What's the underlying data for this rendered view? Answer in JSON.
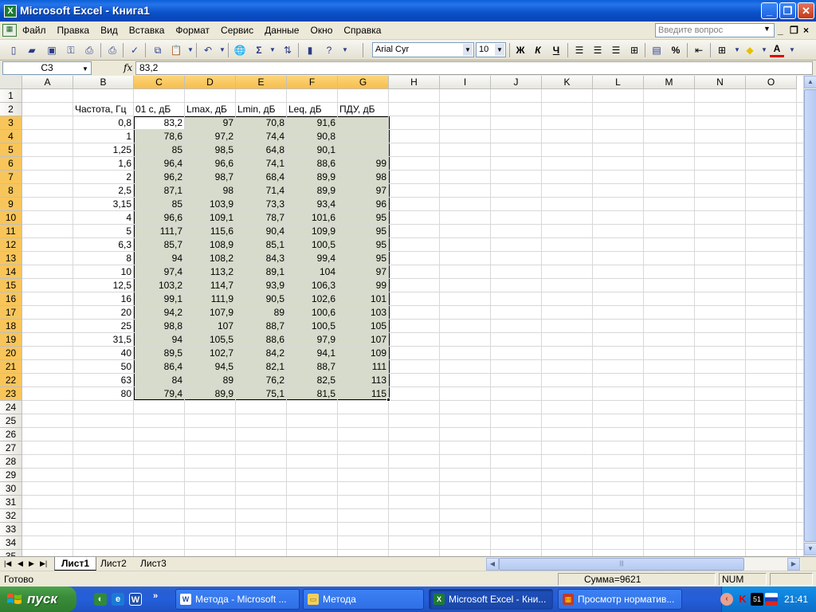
{
  "window": {
    "title": "Microsoft Excel - Книга1"
  },
  "menu": {
    "items": [
      "Файл",
      "Правка",
      "Вид",
      "Вставка",
      "Формат",
      "Сервис",
      "Данные",
      "Окно",
      "Справка"
    ],
    "help_placeholder": "Введите вопрос"
  },
  "toolbar": {
    "font": "Arial Cyr",
    "size": "10"
  },
  "formula_bar": {
    "name_box": "C3",
    "fx": "fx",
    "content": "83,2"
  },
  "grid": {
    "columns": [
      "A",
      "B",
      "C",
      "D",
      "E",
      "F",
      "G",
      "H",
      "I",
      "J",
      "K",
      "L",
      "M",
      "N",
      "O"
    ],
    "rows": [
      "1",
      "2",
      "3",
      "4",
      "5",
      "6",
      "7",
      "8",
      "9",
      "10",
      "11",
      "12",
      "13",
      "14",
      "15",
      "16",
      "17",
      "18",
      "19",
      "20",
      "21",
      "22",
      "23",
      "24",
      "25",
      "26",
      "27",
      "28",
      "29",
      "30",
      "31",
      "32",
      "33",
      "34",
      "35"
    ],
    "headers": [
      "Частота, Гц",
      "01 с, дБ",
      "Lmax, дБ",
      "Lmin, дБ",
      "Leq, дБ",
      "ПДУ, дБ"
    ],
    "data": [
      [
        "0,8",
        "83,2",
        "97",
        "70,8",
        "91,6",
        ""
      ],
      [
        "1",
        "78,6",
        "97,2",
        "74,4",
        "90,8",
        ""
      ],
      [
        "1,25",
        "85",
        "98,5",
        "64,8",
        "90,1",
        ""
      ],
      [
        "1,6",
        "96,4",
        "96,6",
        "74,1",
        "88,6",
        "99"
      ],
      [
        "2",
        "96,2",
        "98,7",
        "68,4",
        "89,9",
        "98"
      ],
      [
        "2,5",
        "87,1",
        "98",
        "71,4",
        "89,9",
        "97"
      ],
      [
        "3,15",
        "85",
        "103,9",
        "73,3",
        "93,4",
        "96"
      ],
      [
        "4",
        "96,6",
        "109,1",
        "78,7",
        "101,6",
        "95"
      ],
      [
        "5",
        "111,7",
        "115,6",
        "90,4",
        "109,9",
        "95"
      ],
      [
        "6,3",
        "85,7",
        "108,9",
        "85,1",
        "100,5",
        "95"
      ],
      [
        "8",
        "94",
        "108,2",
        "84,3",
        "99,4",
        "95"
      ],
      [
        "10",
        "97,4",
        "113,2",
        "89,1",
        "104",
        "97"
      ],
      [
        "12,5",
        "103,2",
        "114,7",
        "93,9",
        "106,3",
        "99"
      ],
      [
        "16",
        "99,1",
        "111,9",
        "90,5",
        "102,6",
        "101"
      ],
      [
        "20",
        "94,2",
        "107,9",
        "89",
        "100,6",
        "103"
      ],
      [
        "25",
        "98,8",
        "107",
        "88,7",
        "100,5",
        "105"
      ],
      [
        "31,5",
        "94",
        "105,5",
        "88,6",
        "97,9",
        "107"
      ],
      [
        "40",
        "89,5",
        "102,7",
        "84,2",
        "94,1",
        "109"
      ],
      [
        "50",
        "86,4",
        "94,5",
        "82,1",
        "88,7",
        "111"
      ],
      [
        "63",
        "84",
        "89",
        "76,2",
        "82,5",
        "113"
      ],
      [
        "80",
        "79,4",
        "89,9",
        "75,1",
        "81,5",
        "115"
      ]
    ]
  },
  "sheets": [
    "Лист1",
    "Лист2",
    "Лист3"
  ],
  "status": {
    "ready": "Готово",
    "sum": "Сумма=9621",
    "num": "NUM"
  },
  "taskbar": {
    "start": "пуск",
    "buttons": [
      "Метода - Microsoft ...",
      "Метода",
      "Microsoft Excel - Кни...",
      "Просмотр норматив..."
    ],
    "tray_count": "51",
    "clock": "21:41"
  },
  "colors": {
    "accent": "#0a5fd8",
    "selection": "#d6dbcb",
    "header_selected": "#f8c55a",
    "start_button": "#3a8c3a"
  }
}
